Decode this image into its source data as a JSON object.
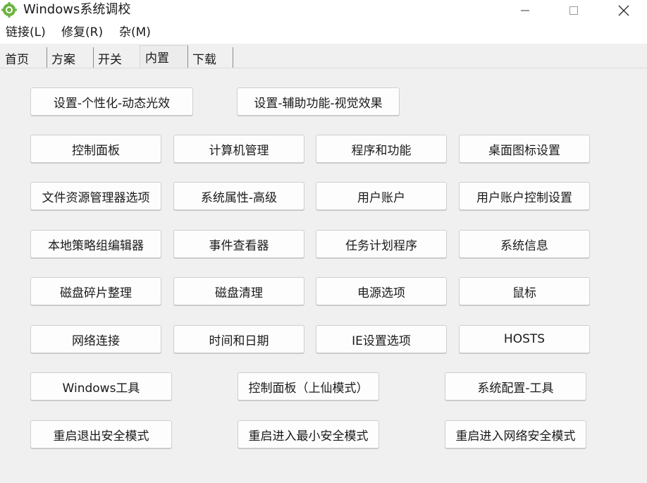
{
  "window": {
    "title": "Windows系统调校",
    "controls": {
      "minimize": "minimize-icon",
      "maximize": "maximize-icon",
      "close": "close-icon"
    },
    "app_icon": "gear-refresh-icon",
    "accent_color": "#6cb33f"
  },
  "menu": {
    "items": [
      "链接(L)",
      "修复(R)",
      "杂(M)"
    ]
  },
  "tabs": {
    "items": [
      "首页",
      "方案",
      "开关",
      "内置",
      "下载"
    ],
    "active": "内置"
  },
  "buttons": {
    "personalize_light": "设置-个性化-动态光效",
    "accessibility_visual": "设置-辅助功能-视觉效果",
    "control_panel": "控制面板",
    "computer_management": "计算机管理",
    "programs_features": "程序和功能",
    "desktop_icons": "桌面图标设置",
    "explorer_options": "文件资源管理器选项",
    "system_properties": "系统属性-高级",
    "user_accounts": "用户账户",
    "uac_settings": "用户账户控制设置",
    "group_policy": "本地策略组编辑器",
    "event_viewer": "事件查看器",
    "task_scheduler": "任务计划程序",
    "system_info": "系统信息",
    "defrag": "磁盘碎片整理",
    "disk_cleanup": "磁盘清理",
    "power_options": "电源选项",
    "mouse": "鼠标",
    "network_connections": "网络连接",
    "date_time": "时间和日期",
    "ie_options": "IE设置选项",
    "hosts": "HOSTS",
    "windows_tools": "Windows工具",
    "god_mode": "控制面板（上仙模式）",
    "msconfig": "系统配置-工具",
    "exit_safe_mode": "重启退出安全模式",
    "minimal_safe_mode": "重启进入最小安全模式",
    "network_safe_mode": "重启进入网络安全模式"
  }
}
